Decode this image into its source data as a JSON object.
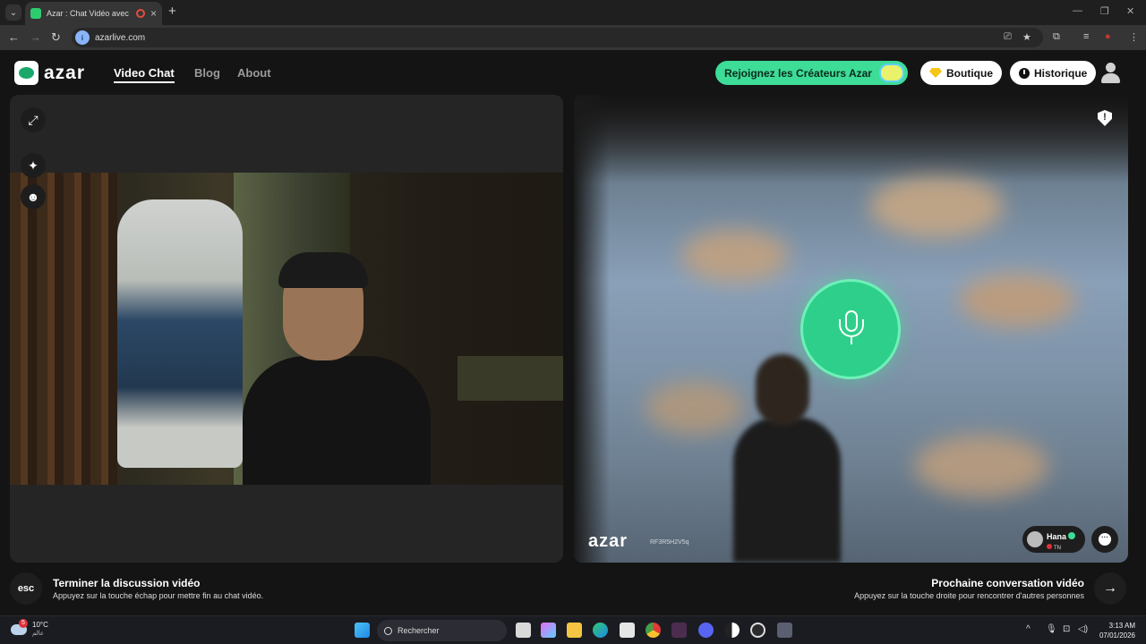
{
  "browser": {
    "tab_title": "Azar : Chat Vidéo avec de n",
    "url": "azarlive.com"
  },
  "header": {
    "logo_text": "azar",
    "nav": [
      "Video Chat",
      "Blog",
      "About"
    ],
    "creators_label": "Rejoignez les Créateurs Azar",
    "shop_label": "Boutique",
    "history_label": "Historique"
  },
  "remote": {
    "watermark": "azar",
    "watermark_id": "RF3R5H2V5q",
    "user_name": "Hana",
    "country_code": "TN"
  },
  "footer": {
    "esc_label": "esc",
    "end_title": "Terminer la discussion vidéo",
    "end_sub": "Appuyez sur la touche échap pour mettre fin au chat vidéo.",
    "next_title": "Prochaine conversation vidéo",
    "next_sub": "Appuyez sur la touche droite pour rencontrer d'autres personnes"
  },
  "taskbar": {
    "temperature": "10°C",
    "location": "عالم",
    "weather_badge": "5",
    "search_placeholder": "Rechercher",
    "time": "3:13 AM",
    "date": "07/01/2026"
  },
  "colors": {
    "accent_green": "#2ecf8a",
    "creators_pill": "#3ddc97"
  }
}
